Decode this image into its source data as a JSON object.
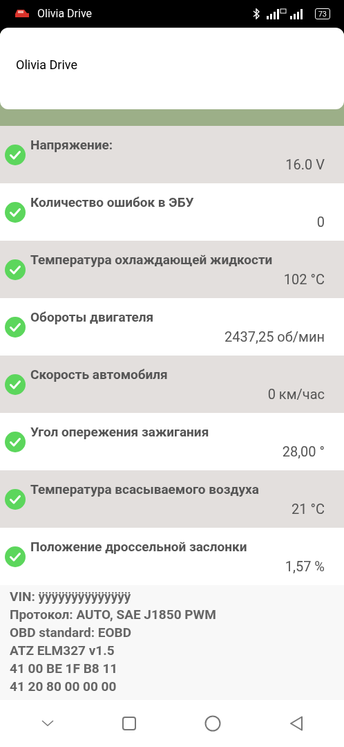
{
  "status_bar": {
    "app_name": "Olivia Drive",
    "battery": "73"
  },
  "header": {
    "title": "Olivia Drive"
  },
  "parameters": [
    {
      "label": "Напряжение:",
      "value": "16.0 V",
      "kind": "ok"
    },
    {
      "label": "Количество ошибок в ЭБУ",
      "value": "0",
      "kind": "ok"
    },
    {
      "label": "Температура охлаждающей жидкости",
      "value": "102 °C",
      "kind": "ok"
    },
    {
      "label": "Обороты двигателя",
      "value": "2437,25 об/мин",
      "kind": "ok"
    },
    {
      "label": "Скорость автомобиля",
      "value": "0 км/час",
      "kind": "ok"
    },
    {
      "label": "Угол опережения зажигания",
      "value": "28,00 °",
      "kind": "ok"
    },
    {
      "label": "Температура всасываемого воздуха",
      "value": "21 °C",
      "kind": "ok"
    },
    {
      "label": "Положение дроссельной заслонки",
      "value": "1,57 %",
      "kind": "ok"
    }
  ],
  "info_lines": [
    "VIN: ÿÿÿÿÿÿÿÿÿÿÿÿÿÿ",
    "Протокол: AUTO, SAE J1850 PWM",
    "OBD standard: EOBD",
    "ATZ ELM327 v1.5",
    "41 00 BE 1F B8 11",
    "41 20 80 00 00 00"
  ]
}
